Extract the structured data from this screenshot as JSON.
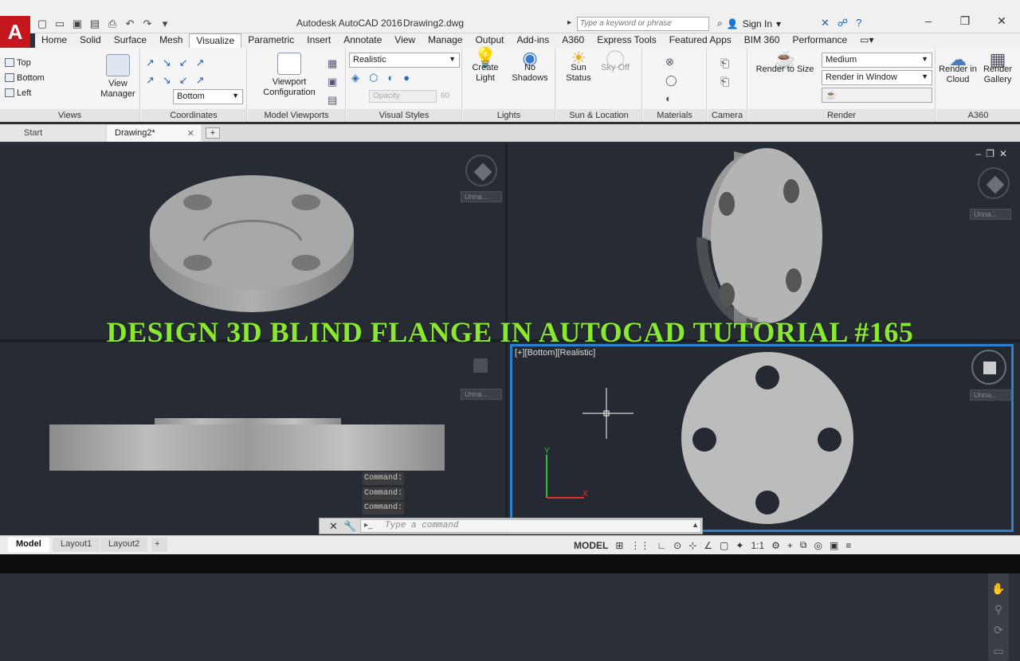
{
  "titlebar": {
    "app_name": "Autodesk AutoCAD 2016",
    "file_name": "Drawing2.dwg",
    "search_placeholder": "Type a keyword or phrase",
    "sign_in": "Sign In"
  },
  "ribbon_tabs": [
    "Home",
    "Solid",
    "Surface",
    "Mesh",
    "Visualize",
    "Parametric",
    "Insert",
    "Annotate",
    "View",
    "Manage",
    "Output",
    "Add-ins",
    "A360",
    "Express Tools",
    "Featured Apps",
    "BIM 360",
    "Performance"
  ],
  "active_tab": "Visualize",
  "panels": {
    "views": {
      "title": "Views",
      "items": [
        "Top",
        "Bottom",
        "Left"
      ],
      "view_manager": "View Manager"
    },
    "coordinates": {
      "title": "Coordinates",
      "ucs_combo": "Bottom"
    },
    "model_viewports": {
      "title": "Model Viewports",
      "viewport_config": "Viewport Configuration"
    },
    "visual_styles": {
      "title": "Visual Styles",
      "style_combo": "Realistic",
      "opacity_label": "Opacity",
      "opacity_value": "60"
    },
    "lights": {
      "title": "Lights",
      "create_light": "Create Light",
      "no_shadows": "No Shadows"
    },
    "sun_location": {
      "title": "Sun & Location",
      "sun_status": "Sun Status",
      "sky_off": "Sky Off"
    },
    "materials": {
      "title": "Materials"
    },
    "camera": {
      "title": "Camera"
    },
    "render": {
      "title": "Render",
      "render_to_size": "Render to Size",
      "quality": "Medium",
      "render_in": "Render in Window"
    },
    "a360": {
      "title": "A360",
      "render_cloud": "Render in Cloud",
      "render_gallery": "Render Gallery"
    }
  },
  "doc_tabs": {
    "start": "Start",
    "current": "Drawing2*"
  },
  "viewports": {
    "bottom_right_label": "[+][Bottom][Realistic]",
    "unnamed": "Unna..."
  },
  "overlay_title": "DESIGN 3D BLIND FLANGE IN AUTOCAD TUTORIAL #165",
  "command_history": [
    "Command:",
    "Command:",
    "Command:"
  ],
  "command_prompt": "Type a command",
  "layout_tabs": [
    "Model",
    "Layout1",
    "Layout2"
  ],
  "status": {
    "model": "MODEL",
    "scale": "1:1"
  },
  "colors": {
    "accent": "#2e7fd0",
    "title_green": "#8be830",
    "app_red": "#c4161c"
  }
}
